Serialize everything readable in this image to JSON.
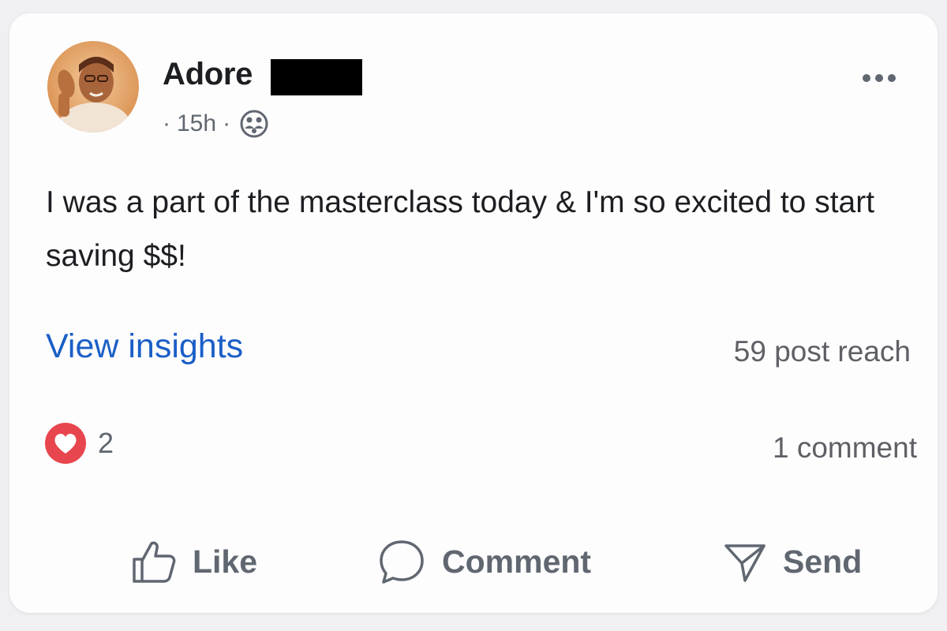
{
  "post": {
    "author": {
      "name": "Adore",
      "avatar_icon": "profile-photo"
    },
    "meta": {
      "separator": "·",
      "time": "15h",
      "audience_icon": "friends-audience-icon"
    },
    "more_icon": "more-options-icon",
    "text": "I was a part of the masterclass today & I'm so excited to start saving $$!",
    "insights_link": "View insights",
    "reach": "59 post reach",
    "reactions": {
      "icon": "heart-reaction-icon",
      "count": "2",
      "color": "#e8464e"
    },
    "comments": "1 comment",
    "actions": {
      "like": "Like",
      "comment": "Comment",
      "send": "Send"
    }
  },
  "colors": {
    "link": "#1b5fc7",
    "secondary_text": "#606770",
    "primary_text": "#1c1e21",
    "card_background": "#fdfdfe"
  }
}
